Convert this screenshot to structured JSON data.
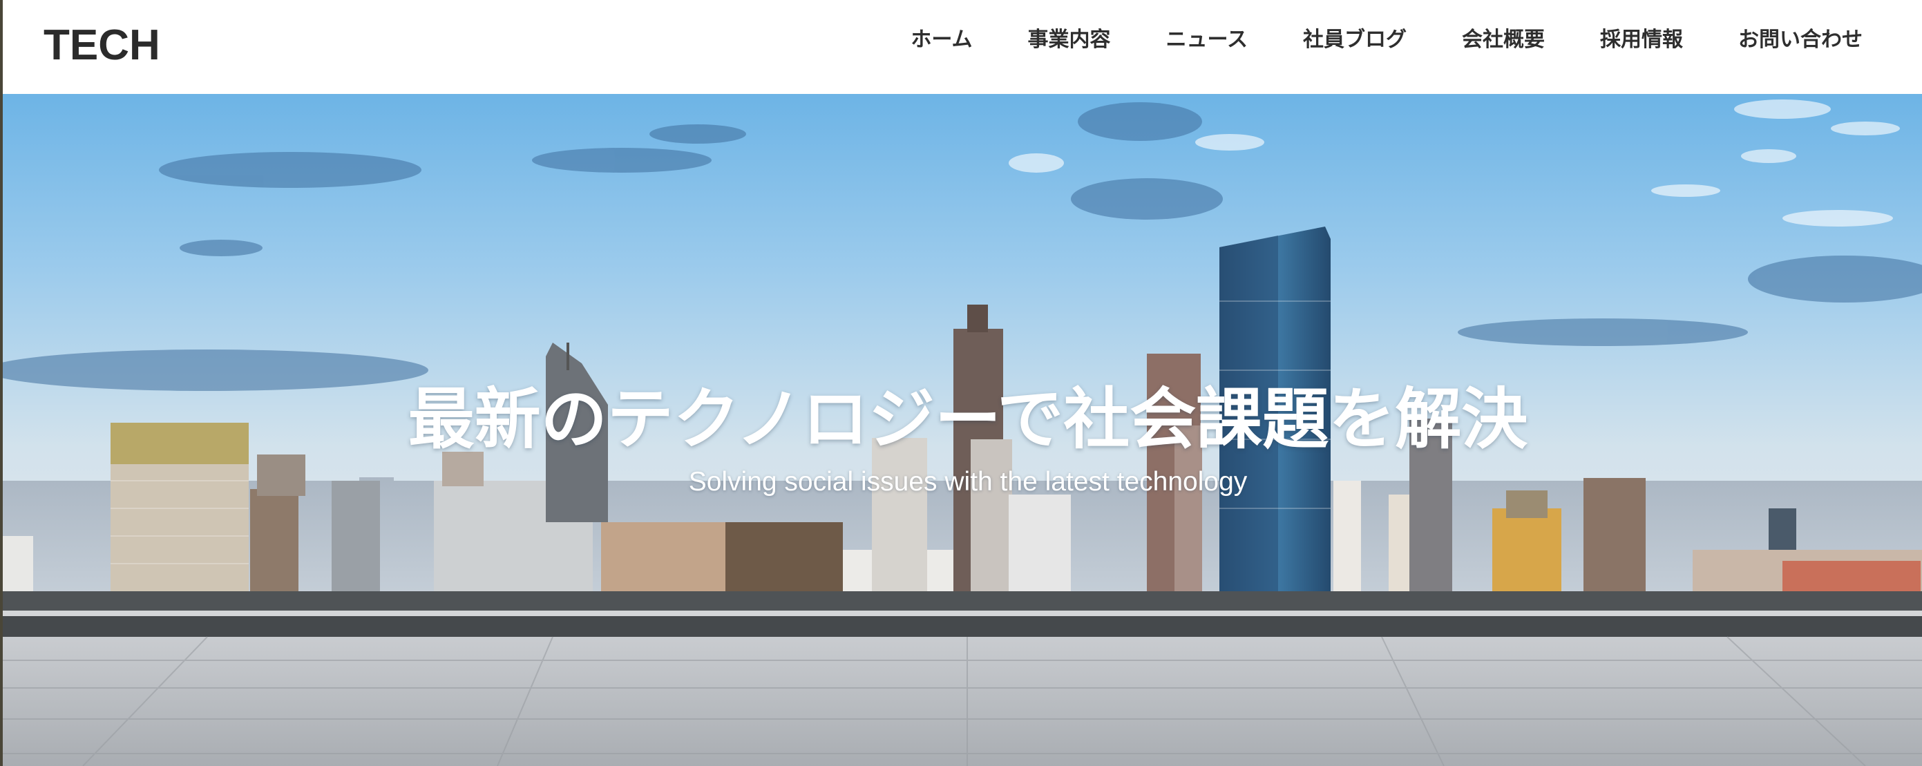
{
  "header": {
    "logo": "TECH",
    "nav": [
      {
        "label": "ホーム"
      },
      {
        "label": "事業内容"
      },
      {
        "label": "ニュース"
      },
      {
        "label": "社員ブログ"
      },
      {
        "label": "会社概要"
      },
      {
        "label": "採用情報"
      },
      {
        "label": "お問い合わせ"
      }
    ]
  },
  "hero": {
    "title": "最新のテクノロジーで社会課題を解決",
    "subtitle": "Solving social issues with the latest technology",
    "image": "city-skyline-rooftop-photo"
  },
  "colors": {
    "header_bg": "#ffffff",
    "nav_text": "#2e2e2e",
    "logo_text": "#2b2b2b",
    "hero_text": "#ffffff",
    "sky_top": "#6fb6e6",
    "sky_horizon": "#dfe8ee"
  }
}
